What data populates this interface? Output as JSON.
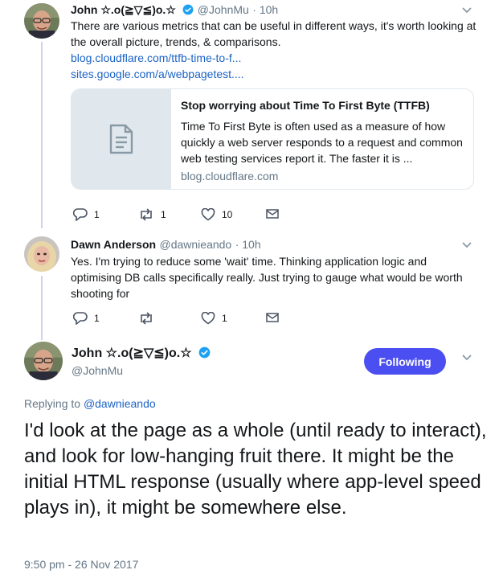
{
  "tweet1": {
    "name": "John ☆.o(≧▽≦)o.☆",
    "handle": "@JohnMu",
    "time": "10h",
    "text": "There are various metrics that can be useful in different ways, it's worth looking at the overall picture, trends, & comparisons.",
    "link1": "blog.cloudflare.com/ttfb-time-to-f...",
    "link2": "sites.google.com/a/webpagetest....",
    "card": {
      "title": "Stop worrying about Time To First Byte (TTFB)",
      "description": "Time To First Byte is often used as a measure of how quickly a web server responds to a request and common web testing services report it. The faster it is ...",
      "domain": "blog.cloudflare.com"
    },
    "actions": {
      "replies": "1",
      "retweets": "1",
      "likes": "10"
    }
  },
  "tweet2": {
    "name": "Dawn Anderson",
    "handle": "@dawnieando",
    "time": "10h",
    "text": "Yes.  I'm trying to reduce some 'wait' time.  Thinking application logic and optimising DB calls specifically really.  Just trying to gauge what would be worth shooting for",
    "actions": {
      "replies": "1",
      "retweets": "",
      "likes": "1"
    }
  },
  "main_tweet": {
    "name": "John ☆.o(≧▽≦)o.☆",
    "handle": "@JohnMu",
    "follow_label": "Following",
    "replying_prefix": "Replying to ",
    "replying_handle": "@dawnieando",
    "text": "I'd look at the page as a whole (until ready to interact), and look for low-hanging fruit there. It might be the initial HTML response (usually where app-level speed plays in), it might be somewhere else.",
    "timestamp": "9:50 pm - 26 Nov 2017"
  },
  "colors": {
    "accent": "#4b4ef0",
    "link": "#1b63c6",
    "muted": "#657786",
    "thread_line": "#cfd3ec",
    "verified": "#1da1f2"
  },
  "icons": [
    "reply-icon",
    "retweet-icon",
    "like-icon",
    "message-icon",
    "verified-icon",
    "caret-down-icon",
    "document-icon"
  ]
}
